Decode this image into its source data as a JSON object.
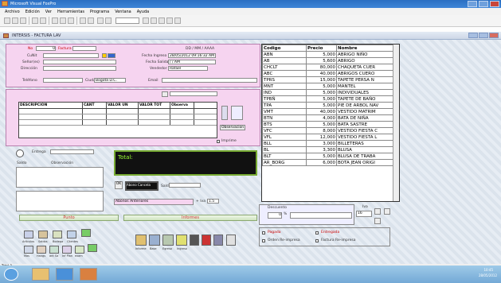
{
  "window": {
    "title": "Microsoft Visual FoxPro"
  },
  "menu": [
    "Archivo",
    "Edición",
    "Ver",
    "Herramientas",
    "Programa",
    "Ventana",
    "Ayuda"
  ],
  "form": {
    "title": "INTERSIS - FACTURA LAV"
  },
  "header": {
    "no_label": "No",
    "no_value": "0",
    "factura_label": "Factura",
    "cuit_label": "CuNit",
    "senores_label": "Señor(es)",
    "direccion_label": "Dirección",
    "telefono_label": "Teléfono",
    "ciudad_label": "Ciudad",
    "ciudad_value": "Bogotá D.C.",
    "email_label": "Email",
    "date_format": "DD / MM / AAAA",
    "fecha_ingreso_label": "Fecha Ingreso",
    "fecha_ingreso_value": "28/05/2012 09:16:32 AM",
    "fecha_salida_label": "Fecha Salida",
    "fecha_salida_value": "/ /     AM",
    "vendedor_label": "Vendedor",
    "vendedor_value": "Rafael"
  },
  "items": {
    "columns": [
      "DESCRIPCION",
      "CANT",
      "VALOR UN",
      "VALOR TOT",
      "Observa"
    ],
    "observacion_button": "Observacion",
    "imprime_label": "Imprime"
  },
  "summary": {
    "entrega_label": "Entrega",
    "saldo_label": "Saldo",
    "observacion_label": "Observación",
    "total_label": "Total:",
    "ok_label": "OK",
    "abono_label": "Abono Cancela",
    "saldo2_label": "Saldo",
    "abonos_anteriores": "Abonos Anteriores",
    "iva_label": "+ Iva",
    "iva_value": "1.5"
  },
  "panels": {
    "punto_title": "Punto",
    "informes_title": "Informes",
    "punto_buttons": [
      "Articulos",
      "Saldos",
      "Bodega",
      "Clientes"
    ],
    "punto_buttons2": [
      "Mas",
      "Hangs",
      "ant Sa",
      "Inf Plan",
      "exam"
    ],
    "informes_buttons": [
      "Informe",
      "Base",
      "Egreso",
      "Ingreso"
    ]
  },
  "prices": {
    "headers": [
      "Codigo",
      "Precio",
      "Nombre"
    ],
    "rows": [
      [
        "ABN",
        "5,000",
        "ABRIGO NIÑO"
      ],
      [
        "AB",
        "5,600",
        "ABRIGO"
      ],
      [
        "CHCLT",
        "80,000",
        "CHAQUETA CUER"
      ],
      [
        "ABC",
        "40,000",
        "ABRIGOS CUERO"
      ],
      [
        "TPRS",
        "15,000",
        "TAPETE PERSA N"
      ],
      [
        "MNT",
        "5,000",
        "MANTEL"
      ],
      [
        "IND",
        "5,000",
        "INDIVIDUALES"
      ],
      [
        "TPBÑ",
        "5,000",
        "TAPETE DE BAÑO"
      ],
      [
        "TPA",
        "5,000",
        "PIE DE ARBOL NAV"
      ],
      [
        "VMT",
        "40,000",
        "VESTIDO MATRIM"
      ],
      [
        "BTN",
        "4,000",
        "BATA DE NIÑA"
      ],
      [
        "BTS",
        "5,000",
        "BATA SASTRE"
      ],
      [
        "VFC",
        "8,000",
        "VESTIDO FIESTA C"
      ],
      [
        "VFL",
        "12,000",
        "VESTIDO FIESTA L"
      ],
      [
        "BLL",
        "3,000",
        "BILLETERAS"
      ],
      [
        "BL",
        "3,300",
        "BLUSA"
      ],
      [
        "BLT",
        "5,000",
        "BLUSA DE TRABA"
      ],
      [
        "AR_BORG",
        "6,000",
        "BOTA JEAN ORIGI"
      ]
    ]
  },
  "lower_right": {
    "descuento_label": "Descuento",
    "descuento_value": "0",
    "iva_label": "Iva",
    "iva_value": "16",
    "pagada_label": "Pagada",
    "entregada_label": "Entregada",
    "orden_label": "Orden Re-impresa",
    "factura_label": "Factura Re-impresa"
  },
  "status": {
    "text": "Total-1"
  },
  "taskbar": {
    "time": "10:45",
    "date": "28/05/2012"
  }
}
